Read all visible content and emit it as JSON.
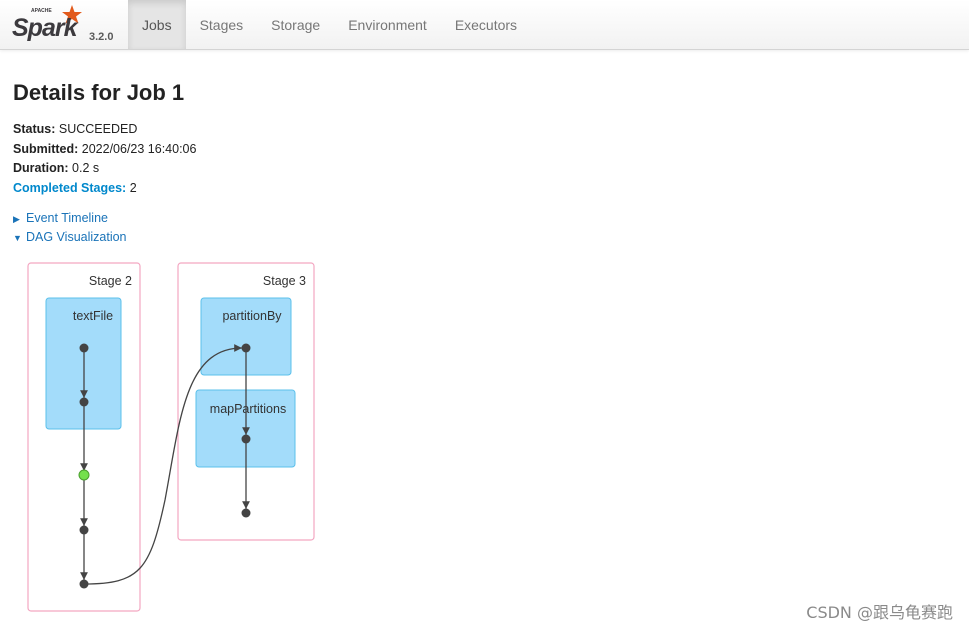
{
  "brand": {
    "apache_text": "APACHE",
    "name": "Spark",
    "version": "3.2.0",
    "colors": {
      "star": "#e25a1c",
      "wordmark": "#3c3a3e"
    }
  },
  "nav": {
    "items": [
      "Jobs",
      "Stages",
      "Storage",
      "Environment",
      "Executors"
    ],
    "active": "Jobs"
  },
  "page": {
    "title": "Details for Job 1"
  },
  "summary": {
    "status_label": "Status:",
    "status_value": "SUCCEEDED",
    "submitted_label": "Submitted:",
    "submitted_value": "2022/06/23 16:40:06",
    "duration_label": "Duration:",
    "duration_value": "0.2 s",
    "completed_stages_label": "Completed Stages:",
    "completed_stages_value": "2"
  },
  "toggles": {
    "event_timeline": {
      "label": "Event Timeline",
      "expanded": false,
      "icon": "caret-right-icon"
    },
    "dag_visualization": {
      "label": "DAG Visualization",
      "expanded": true,
      "icon": "caret-down-icon"
    }
  },
  "dag": {
    "colors": {
      "stage_border": "#f3a6c1",
      "cluster_fill": "#a3dcfa",
      "cluster_border": "#5bc0eb",
      "node": "#444444",
      "highlight_node": "#74e04c"
    },
    "stages": [
      {
        "label": "Stage 2",
        "clusters": [
          {
            "label": "textFile"
          }
        ],
        "node_count": 5,
        "highlighted_node": 3
      },
      {
        "label": "Stage 3",
        "clusters": [
          {
            "label": "partitionBy"
          },
          {
            "label": "mapPartitions"
          }
        ],
        "node_count": 3
      }
    ]
  },
  "watermark": "CSDN @跟乌龟赛跑"
}
